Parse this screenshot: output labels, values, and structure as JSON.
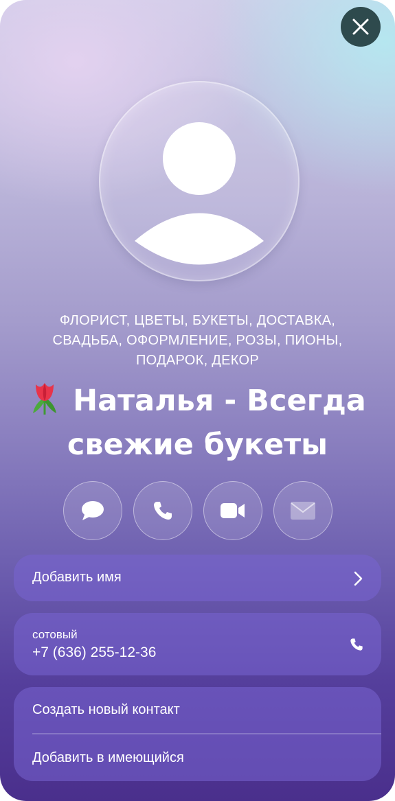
{
  "close": {
    "icon": "close-icon"
  },
  "contact": {
    "categories": [
      "ФЛОРИСТ, ЦВЕТЫ, БУКЕТЫ, ДОСТАВКА,",
      "СВАДЬБА, ОФОРМЛЕНИЕ, РОЗЫ, ПИОНЫ,",
      "ПОДАРОК, ДЕКОР"
    ],
    "name_line1": "Наталья - Всегда",
    "name_line2": "свежие букеты",
    "name_emoji": "tulip-icon"
  },
  "actions": [
    {
      "name": "message",
      "icon": "message-bubble-icon"
    },
    {
      "name": "call",
      "icon": "phone-icon"
    },
    {
      "name": "video",
      "icon": "video-camera-icon"
    },
    {
      "name": "mail",
      "icon": "envelope-icon"
    }
  ],
  "add_name": {
    "label": "Добавить имя"
  },
  "phone": {
    "type_label": "сотовый",
    "number": "+7 (636) 255-12-36"
  },
  "contact_actions": {
    "create_new": "Создать новый контакт",
    "add_existing": "Добавить в имеющийся"
  },
  "colors": {
    "close_button": "#2e4a4d",
    "card_fill": "rgba(120,100,210,0.55)",
    "text": "#ffffff"
  }
}
